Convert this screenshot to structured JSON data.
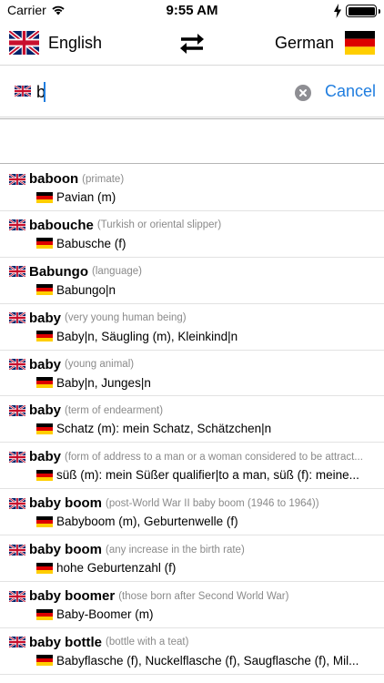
{
  "status_bar": {
    "carrier": "Carrier",
    "time": "9:55 AM",
    "battery_level": 1.0
  },
  "languages": {
    "source": {
      "name": "English",
      "flag": "uk-flag-icon"
    },
    "target": {
      "name": "German",
      "flag": "german-flag-icon"
    },
    "swap_icon": "swap-arrows-icon"
  },
  "search": {
    "value": "b",
    "cancel_label": "Cancel",
    "clear_icon": "clear-icon"
  },
  "results": [
    {
      "term": "baboon",
      "desc": "(primate)",
      "trans": "Pavian (m)"
    },
    {
      "term": "babouche",
      "desc": "(Turkish or oriental slipper)",
      "trans": "Babusche (f)"
    },
    {
      "term": "Babungo",
      "desc": "(language)",
      "trans": "Babungo|n"
    },
    {
      "term": "baby",
      "desc": "(very young human being)",
      "trans": "Baby|n, Säugling (m), Kleinkind|n"
    },
    {
      "term": "baby",
      "desc": "(young animal)",
      "trans": "Baby|n, Junges|n"
    },
    {
      "term": "baby",
      "desc": "(term of endearment)",
      "trans": "Schatz (m): mein Schatz, Schätzchen|n"
    },
    {
      "term": "baby",
      "desc": "(form of address to a man or a woman considered to be attract...",
      "trans": "süß (m): mein Süßer qualifier|to a man, süß (f): meine..."
    },
    {
      "term": "baby boom",
      "desc": "(post-World War II baby boom (1946 to 1964))",
      "trans": "Babyboom (m), Geburtenwelle (f)"
    },
    {
      "term": "baby boom",
      "desc": "(any increase in the birth rate)",
      "trans": "hohe Geburtenzahl (f)"
    },
    {
      "term": "baby boomer",
      "desc": "(those born after Second World War)",
      "trans": "Baby-Boomer (m)"
    },
    {
      "term": "baby bottle",
      "desc": "(bottle with a teat)",
      "trans": "Babyflasche (f), Nuckelflasche (f), Saugflasche (f), Mil..."
    }
  ]
}
